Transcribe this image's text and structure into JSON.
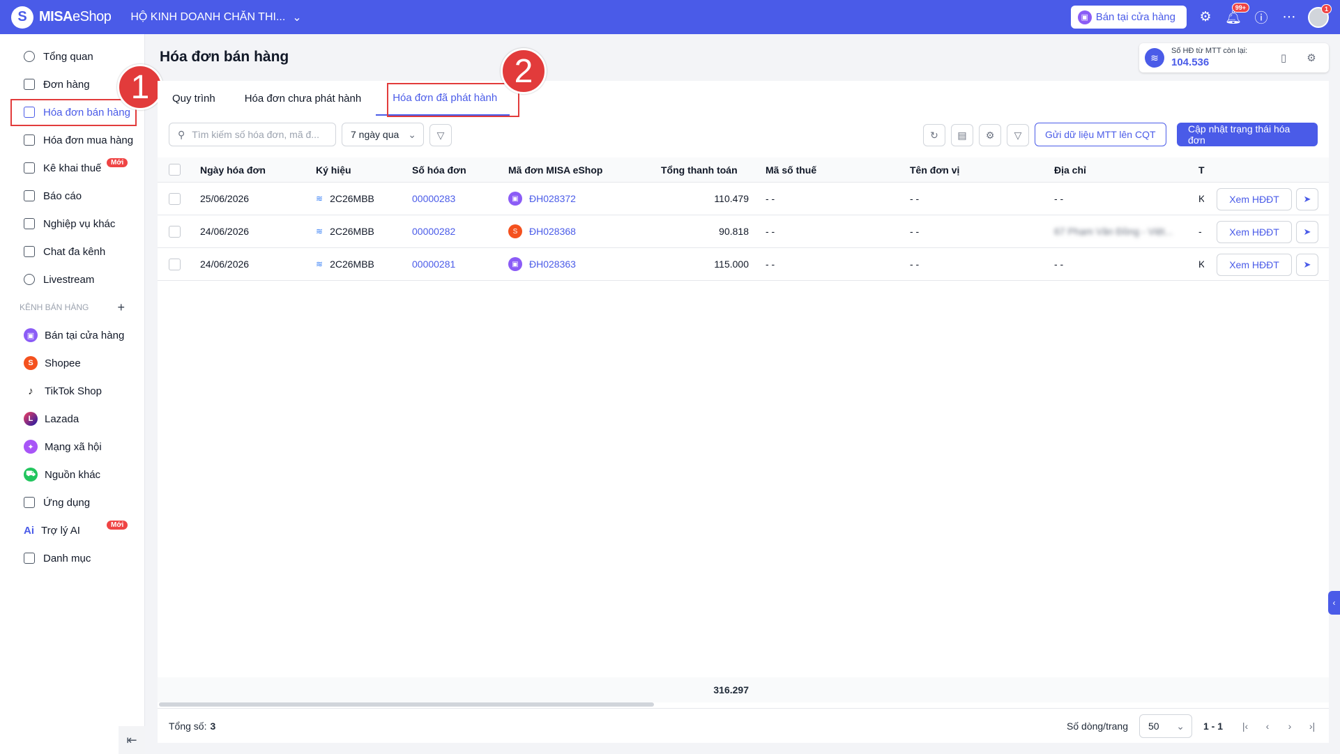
{
  "header": {
    "logo_mark": "S",
    "logo_bold": "MISA",
    "logo_light": "eShop",
    "store_name": "HỘ KINH DOANH CHĂN THI...",
    "store_button": "Bán tại cửa hàng",
    "notification_count": "99+",
    "avatar_badge": "1"
  },
  "sidebar": {
    "items": [
      {
        "label": "Tổng quan"
      },
      {
        "label": "Đơn hàng"
      },
      {
        "label": "Hóa đơn bán hàng"
      },
      {
        "label": "Hóa đơn mua hàng"
      },
      {
        "label": "Kê khai thuế",
        "badge": "Mới"
      },
      {
        "label": "Báo cáo"
      },
      {
        "label": "Nghiệp vụ khác"
      },
      {
        "label": "Chat đa kênh"
      },
      {
        "label": "Livestream"
      }
    ],
    "channels_title": "KÊNH BÁN HÀNG",
    "channels": [
      {
        "label": "Bán tại cửa hàng",
        "color": "#8b5cf6"
      },
      {
        "label": "Shopee",
        "color": "#f4511e"
      },
      {
        "label": "TikTok Shop",
        "color": "#111111"
      },
      {
        "label": "Lazada",
        "color": "#1a1aa6"
      },
      {
        "label": "Mạng xã hội",
        "color": "#a855f7"
      },
      {
        "label": "Nguồn khác",
        "color": "#22c55e"
      }
    ],
    "bottom_items": [
      {
        "label": "Ứng dụng"
      },
      {
        "label": "Trợ lý AI",
        "badge": "Mới",
        "icon_text": "Ai"
      },
      {
        "label": "Danh mục"
      }
    ]
  },
  "annotations": {
    "step1": "1",
    "step2": "2"
  },
  "page": {
    "title": "Hóa đơn bán hàng",
    "quota_label": "Số HĐ từ MTT còn lại:",
    "quota_value": "104.536"
  },
  "tabs": [
    {
      "label": "Quy trình"
    },
    {
      "label": "Hóa đơn chưa phát hành"
    },
    {
      "label": "Hóa đơn đã phát hành"
    }
  ],
  "toolbar": {
    "search_placeholder": "Tìm kiếm số hóa đơn, mã đ...",
    "date_filter": "7 ngày qua",
    "send_mtt_button": "Gửi dữ liệu MTT lên CQT",
    "update_status_button": "Cập nhật trạng thái hóa đơn"
  },
  "table": {
    "columns": [
      "Ngày hóa đơn",
      "Ký hiệu",
      "Số hóa đơn",
      "Mã đơn MISA eShop",
      "Tổng thanh toán",
      "Mã số thuế",
      "Tên đơn vị",
      "Địa chỉ",
      "T"
    ],
    "rows": [
      {
        "date": "25/06/2026",
        "symbol": "2C26MBB",
        "number": "00000283",
        "order": "ĐH028372",
        "order_channel": "store",
        "total": "110.479",
        "tax": "- -",
        "unit": "- -",
        "address": "- -",
        "trunc": "K"
      },
      {
        "date": "24/06/2026",
        "symbol": "2C26MBB",
        "number": "00000282",
        "order": "ĐH028368",
        "order_channel": "shopee",
        "total": "90.818",
        "tax": "- -",
        "unit": "- -",
        "address": "67 Phạm Văn Đồng - Việt...",
        "trunc": "-"
      },
      {
        "date": "24/06/2026",
        "symbol": "2C26MBB",
        "number": "00000281",
        "order": "ĐH028363",
        "order_channel": "store",
        "total": "115.000",
        "tax": "- -",
        "unit": "- -",
        "address": "- -",
        "trunc": "K"
      }
    ],
    "view_button": "Xem HĐĐT",
    "grand_total": "316.297"
  },
  "footer": {
    "total_label": "Tổng số:",
    "total_count": "3",
    "rows_per_page_label": "Số dòng/trang",
    "rows_per_page": "50",
    "page_range": "1 - 1"
  }
}
